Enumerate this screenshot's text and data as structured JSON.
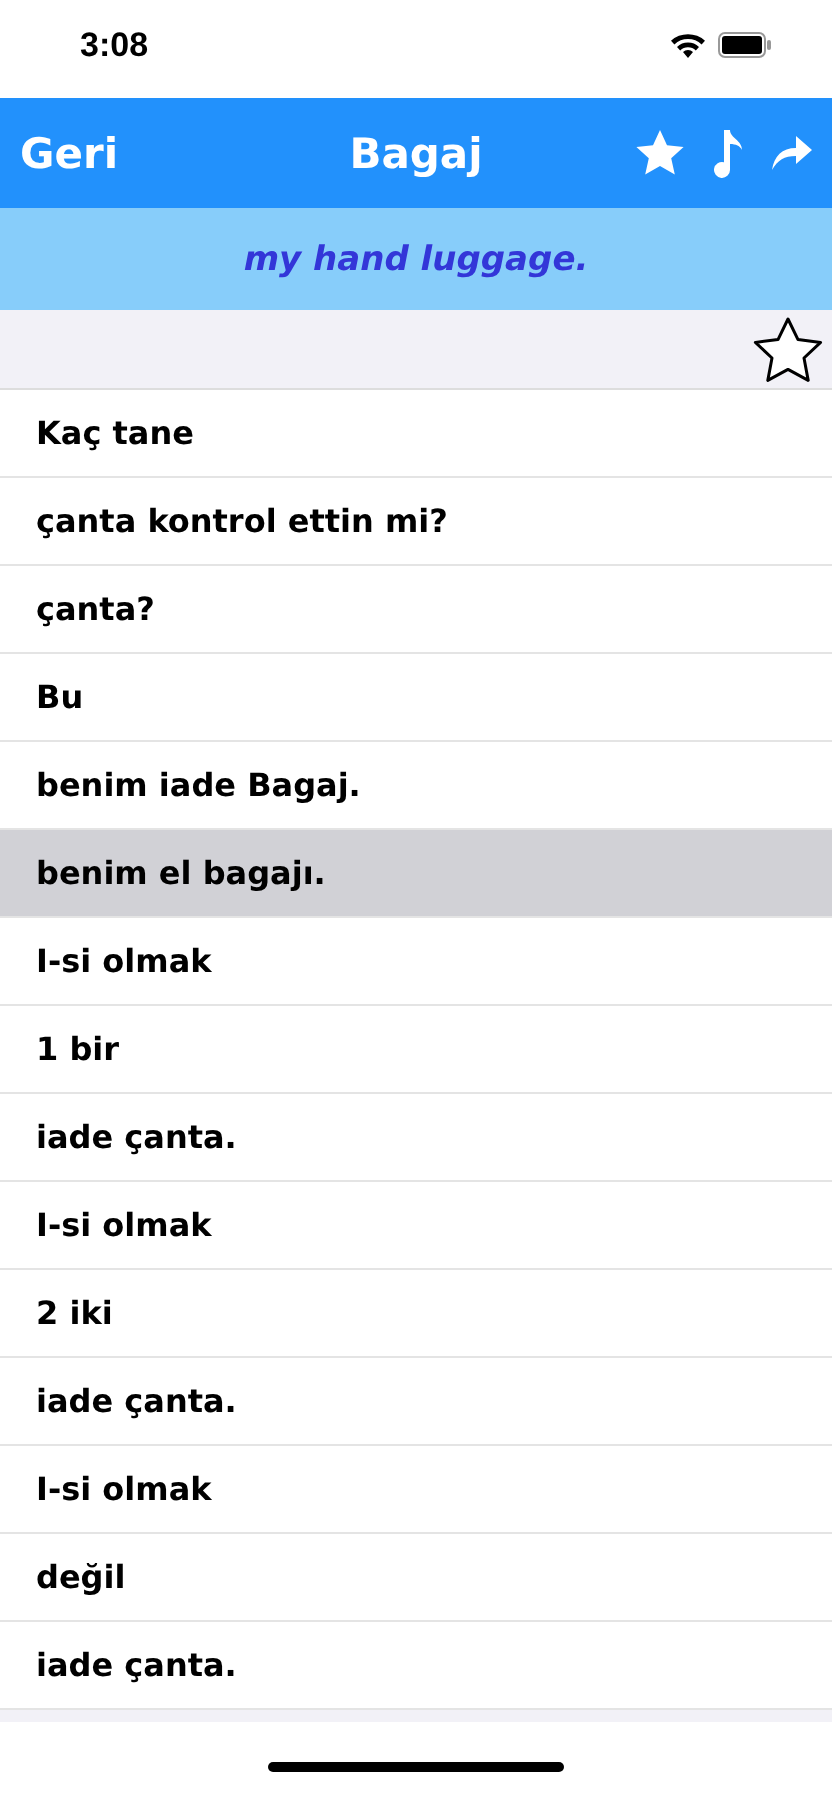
{
  "status_bar": {
    "time": "3:08"
  },
  "nav": {
    "back": "Geri",
    "title": "Bagaj"
  },
  "translation": "my hand luggage.",
  "favorite": false,
  "rows": [
    {
      "text": "Kaç tane",
      "selected": false
    },
    {
      "text": "çanta kontrol ettin mi?",
      "selected": false
    },
    {
      "text": "çanta?",
      "selected": false
    },
    {
      "text": "Bu",
      "selected": false
    },
    {
      "text": "benim iade Bagaj.",
      "selected": false
    },
    {
      "text": "benim el bagajı.",
      "selected": true
    },
    {
      "text": "I-si olmak",
      "selected": false
    },
    {
      "text": "1 bir",
      "selected": false
    },
    {
      "text": "iade çanta.",
      "selected": false
    },
    {
      "text": "I-si olmak",
      "selected": false
    },
    {
      "text": "2 iki",
      "selected": false
    },
    {
      "text": "iade çanta.",
      "selected": false
    },
    {
      "text": "I-si olmak",
      "selected": false
    },
    {
      "text": "değil",
      "selected": false
    },
    {
      "text": "iade çanta.",
      "selected": false
    }
  ]
}
